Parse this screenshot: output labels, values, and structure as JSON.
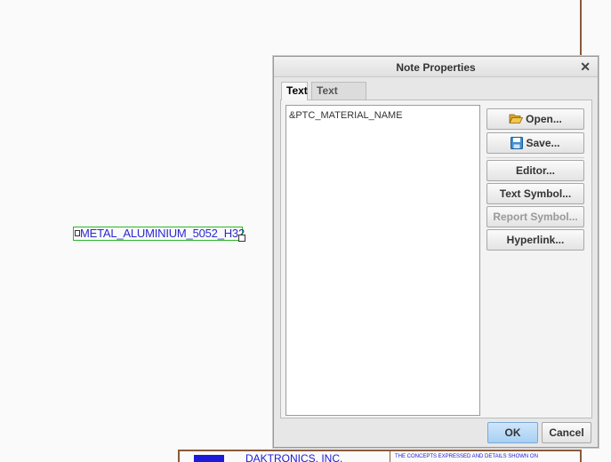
{
  "drawing": {
    "note_text": "METAL_ALUMINIUM_5052_H32",
    "title_block": {
      "company": "DAKTRONICS, INC.",
      "notice": "THE CONCEPTS EXPRESSED AND DETAILS SHOWN ON"
    }
  },
  "dialog": {
    "title": "Note Properties",
    "close_glyph": "✕",
    "tabs": [
      {
        "label": "Text",
        "active": true
      },
      {
        "label": "Text Style",
        "active": false
      }
    ],
    "text_value": "&PTC_MATERIAL_NAME",
    "side_buttons": {
      "open": "Open...",
      "save": "Save...",
      "editor": "Editor...",
      "text_symbol": "Text Symbol...",
      "report_symbol": "Report Symbol...",
      "hyperlink": "Hyperlink..."
    },
    "footer": {
      "ok": "OK",
      "cancel": "Cancel"
    }
  },
  "colors": {
    "note_text": "#2a2ad0",
    "selection_box": "#2db52d",
    "border_lines": "#8a5a3a",
    "ok_button": "#a7cff3"
  },
  "icons": {
    "open": "folder-open-icon",
    "save": "floppy-disk-icon"
  }
}
